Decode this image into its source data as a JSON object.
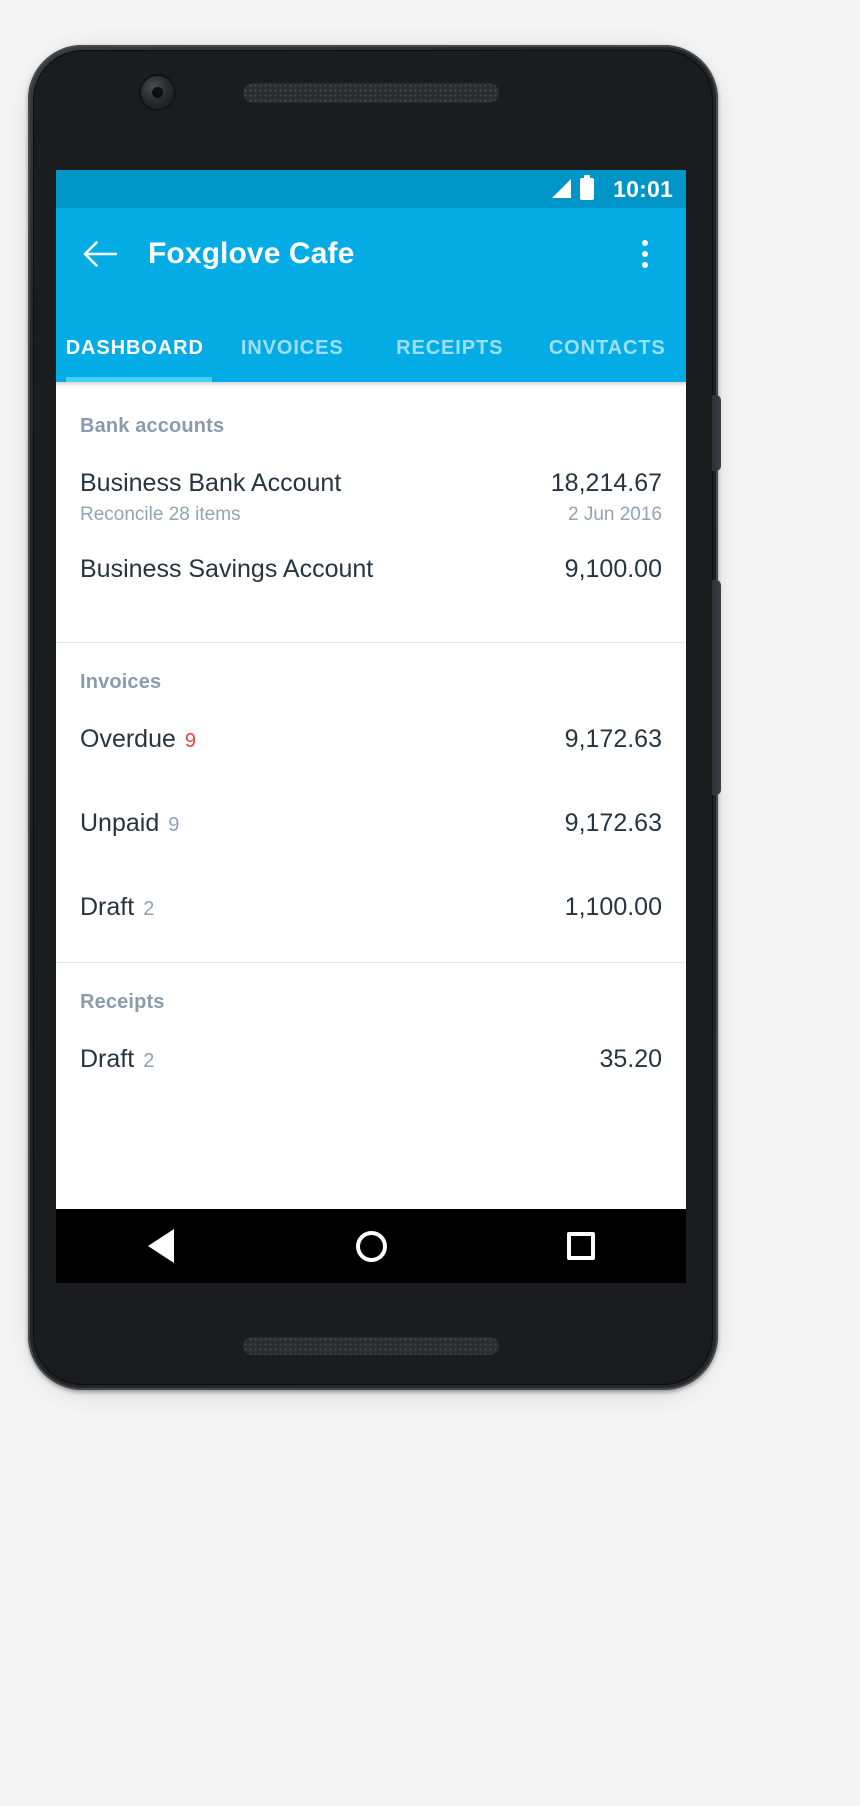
{
  "statusbar": {
    "time": "10:01",
    "signal_icon": "signal-bars-icon",
    "battery_icon": "battery-full-icon"
  },
  "appbar": {
    "back_icon": "back-arrow-icon",
    "title": "Foxglove Cafe",
    "overflow_icon": "overflow-menu-icon"
  },
  "tabs": [
    {
      "label": "DASHBOARD",
      "active": true
    },
    {
      "label": "INVOICES",
      "active": false
    },
    {
      "label": "RECEIPTS",
      "active": false
    },
    {
      "label": "CONTACTS",
      "active": false
    }
  ],
  "sections": {
    "bank_accounts": {
      "header": "Bank accounts",
      "rows": [
        {
          "title": "Business Bank Account",
          "subtitle": "Reconcile 28 items",
          "amount": "18,214.67",
          "date": "2 Jun 2016"
        },
        {
          "title": "Business Savings Account",
          "subtitle": "",
          "amount": "9,100.00",
          "date": ""
        }
      ]
    },
    "invoices": {
      "header": "Invoices",
      "rows": [
        {
          "title": "Overdue",
          "count": "9",
          "count_color": "#e8453c",
          "amount": "9,172.63"
        },
        {
          "title": "Unpaid",
          "count": "9",
          "count_color": "#8fa1b4",
          "amount": "9,172.63"
        },
        {
          "title": "Draft",
          "count": "2",
          "count_color": "#8fa1b4",
          "amount": "1,100.00"
        }
      ]
    },
    "receipts": {
      "header": "Receipts",
      "rows": [
        {
          "title": "Draft",
          "count": "2",
          "count_color": "#8fa1b4",
          "amount": "35.20"
        }
      ]
    }
  },
  "navbar": {
    "back_icon": "nav-back-triangle-icon",
    "home_icon": "nav-home-circle-icon",
    "recents_icon": "nav-recents-square-icon"
  },
  "theme": {
    "accent": "#03ace4",
    "statusbar_bg": "#0095c8",
    "indicator": "#46d2f5",
    "text_dark": "#26353f",
    "text_muted": "#93a3b3",
    "section_header": "#8a9bad",
    "danger": "#e8453c"
  }
}
